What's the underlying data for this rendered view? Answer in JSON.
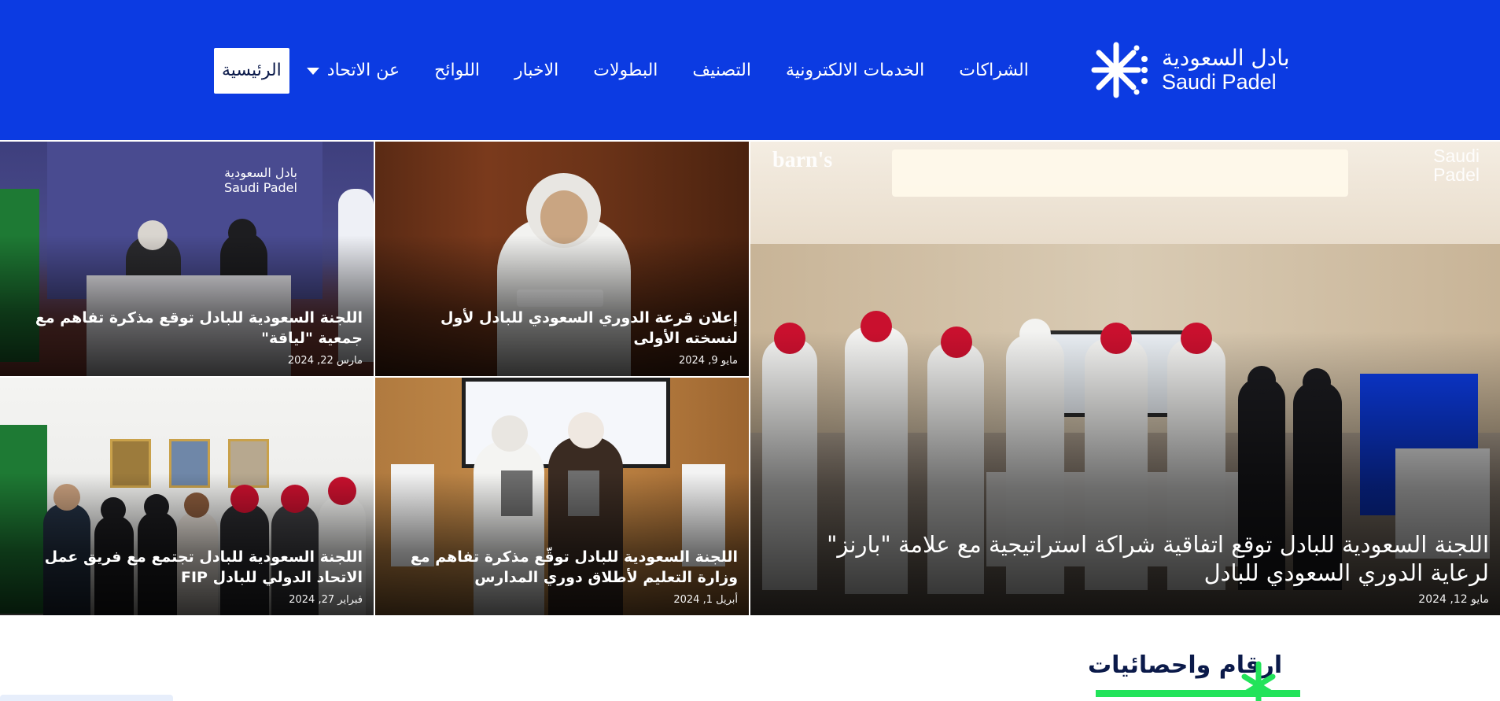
{
  "header": {
    "logo_ar": "بادل السعودية",
    "logo_en": "Saudi Padel",
    "nav": [
      {
        "label": "الرئيسية",
        "active": true,
        "dropdown": false
      },
      {
        "label": "عن الاتحاد",
        "active": false,
        "dropdown": true
      },
      {
        "label": "اللوائح",
        "active": false,
        "dropdown": false
      },
      {
        "label": "الاخبار",
        "active": false,
        "dropdown": false
      },
      {
        "label": "البطولات",
        "active": false,
        "dropdown": false
      },
      {
        "label": "التصنيف",
        "active": false,
        "dropdown": false
      },
      {
        "label": "الخدمات الالكترونية",
        "active": false,
        "dropdown": false
      },
      {
        "label": "الشراكات",
        "active": false,
        "dropdown": false
      }
    ]
  },
  "news": {
    "featured": {
      "title": "اللجنة السعودية للبادل توقع اتفاقية شراكة استراتيجية مع علامة \"بارنز\" لرعاية الدوري السعودي للبادل",
      "date": "مايو 12, 2024",
      "watermark_left": "barn's",
      "watermark_right": "Saudi Padel"
    },
    "cards": [
      {
        "title": "إعلان قرعة الدوري السعودي للبادل لأول لنسخته الأولى",
        "date": "مايو 9, 2024"
      },
      {
        "title": "اللجنة السعودية للبادل توقع مذكرة تفاهم مع جمعية \"لياقة\"",
        "date": "مارس 22, 2024",
        "backdrop_ar": "بادل السعودية",
        "backdrop_en": "Saudi Padel"
      },
      {
        "title": "اللجنة السعودية للبادل توقّع مذكرة تفاهم مع وزارة التعليم لأطلاق دوري المدارس",
        "date": "أبريل 1, 2024"
      },
      {
        "title": "اللجنة السعودية للبادل تجتمع مع فريق عمل الاتحاد الدولي للبادل FIP",
        "date": "فبراير 27, 2024"
      }
    ]
  },
  "stats": {
    "title": "ارقام واحصائيات"
  },
  "colors": {
    "brand_blue": "#0c3be2",
    "accent_green": "#22e35a",
    "navy": "#0b1a4a"
  },
  "icons": [
    "saudi-padel-logo-icon",
    "chevron-down-icon",
    "sparkle-mark-icon"
  ]
}
